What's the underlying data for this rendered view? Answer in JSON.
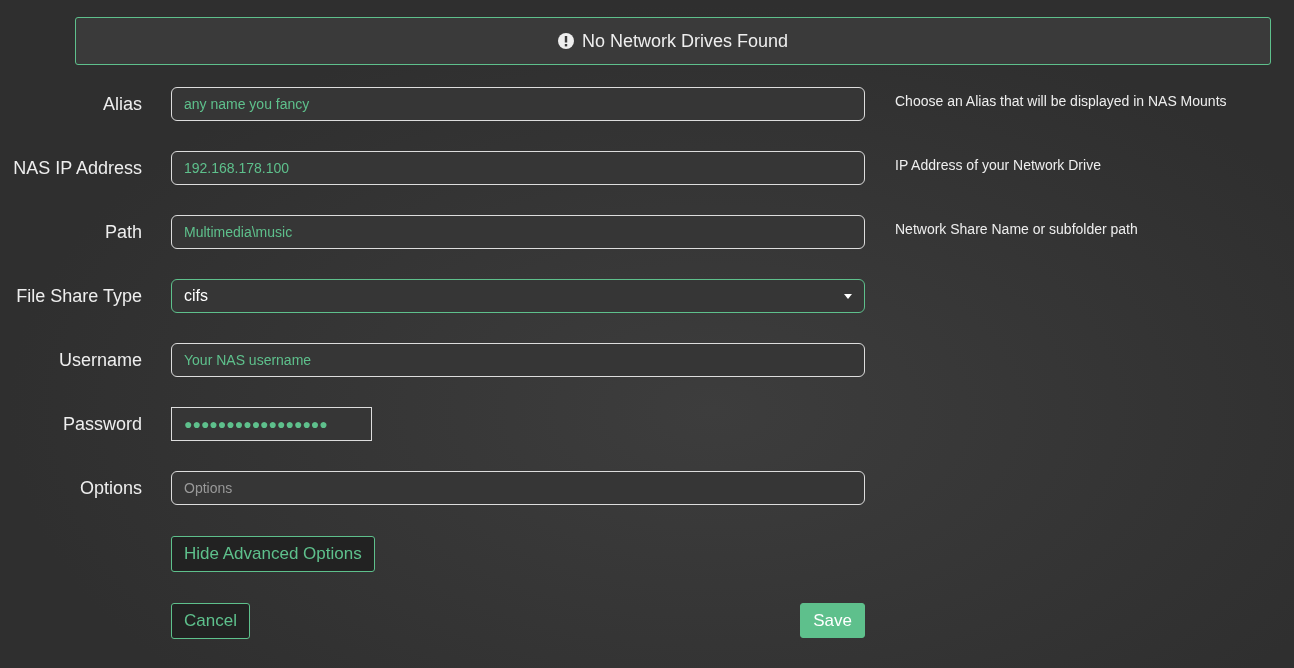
{
  "alert": {
    "text": "No Network Drives Found"
  },
  "fields": [
    {
      "kind": "text",
      "label": "Alias",
      "value": "any name you fancy",
      "help": "Choose an Alias that will be displayed in NAS Mounts"
    },
    {
      "kind": "text",
      "label": "NAS IP Address",
      "value": "192.168.178.100",
      "help": "IP Address of your Network Drive"
    },
    {
      "kind": "text",
      "label": "Path",
      "value": "Multimedia\\music",
      "help": "Network Share Name or subfolder path"
    },
    {
      "kind": "select",
      "label": "File Share Type",
      "value": "cifs"
    },
    {
      "kind": "text",
      "label": "Username",
      "value": "Your NAS username"
    },
    {
      "kind": "password",
      "label": "Password",
      "value": "●●●●●●●●●●●●●●●●●"
    },
    {
      "kind": "text",
      "label": "Options",
      "placeholder": "Options"
    }
  ],
  "toggle_button": "Hide Advanced Options",
  "buttons": {
    "cancel": "Cancel",
    "save": "Save"
  }
}
